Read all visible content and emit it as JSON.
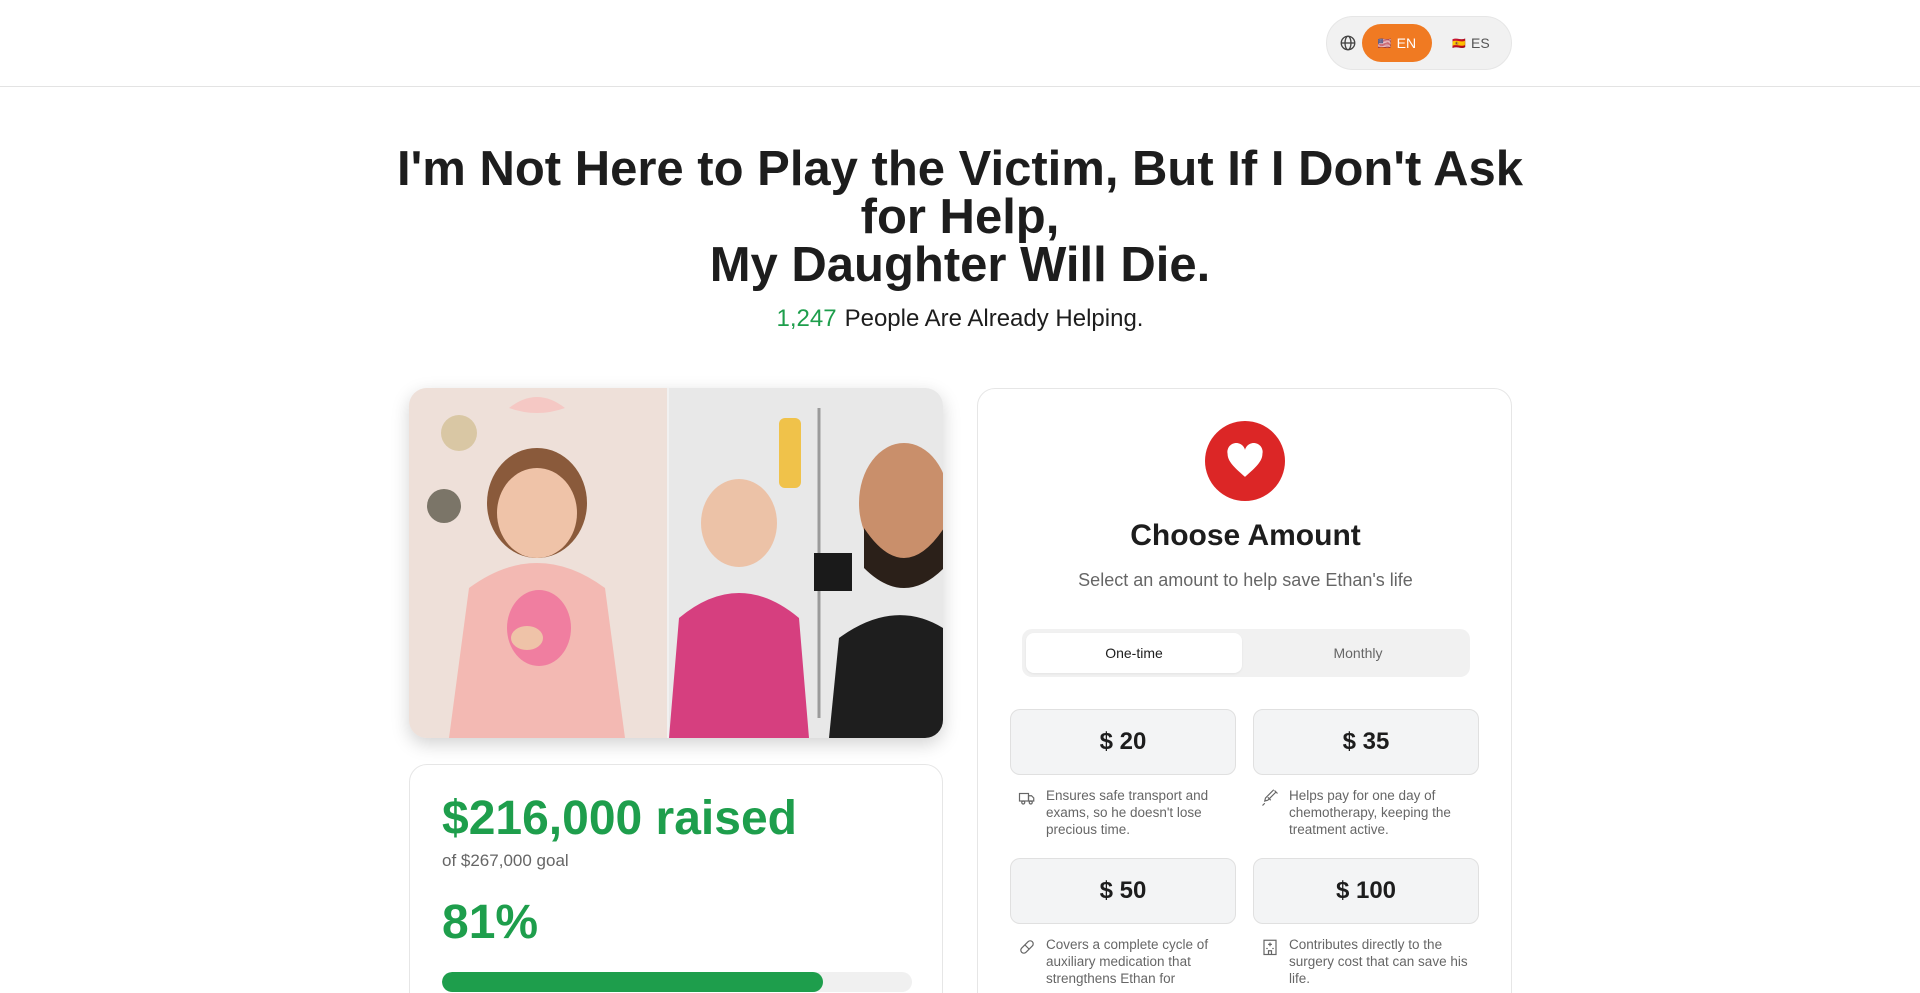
{
  "header": {
    "languages": [
      {
        "flag": "🇺🇸",
        "code": "EN",
        "active": true
      },
      {
        "flag": "🇪🇸",
        "code": "ES",
        "active": false
      }
    ],
    "accent_color": "#f07a22"
  },
  "hero": {
    "headline_line1": "I'm Not Here to Play the Victim, But If I Don't Ask",
    "headline_line2": "for Help,",
    "headline_line3": "My Daughter Will Die.",
    "helpers_count": "1,247",
    "helpers_text": "People Are Already Helping."
  },
  "progress": {
    "raised": "$216,000 raised",
    "goal": "of $267,000 goal",
    "percent_label": "81%",
    "percent_value": 0.81,
    "color": "#1e9e4c"
  },
  "donate": {
    "title": "Choose Amount",
    "subtitle": "Select an amount to help save Ethan's life",
    "frequency": {
      "one_time": "One-time",
      "monthly": "Monthly",
      "selected": "One-time"
    },
    "amounts": [
      {
        "label": "$ 20",
        "icon": "truck-icon",
        "description": "Ensures safe transport and exams, so he doesn't lose precious time."
      },
      {
        "label": "$ 35",
        "icon": "syringe-icon",
        "description": "Helps pay for one day of chemotherapy, keeping the treatment active."
      },
      {
        "label": "$ 50",
        "icon": "pill-icon",
        "description": "Covers a complete cycle of auxiliary medication that strengthens Ethan for"
      },
      {
        "label": "$ 100",
        "icon": "hospital-icon",
        "description": "Contributes directly to the surgery cost that can save his life."
      }
    ],
    "heart_color": "#dc2626"
  }
}
